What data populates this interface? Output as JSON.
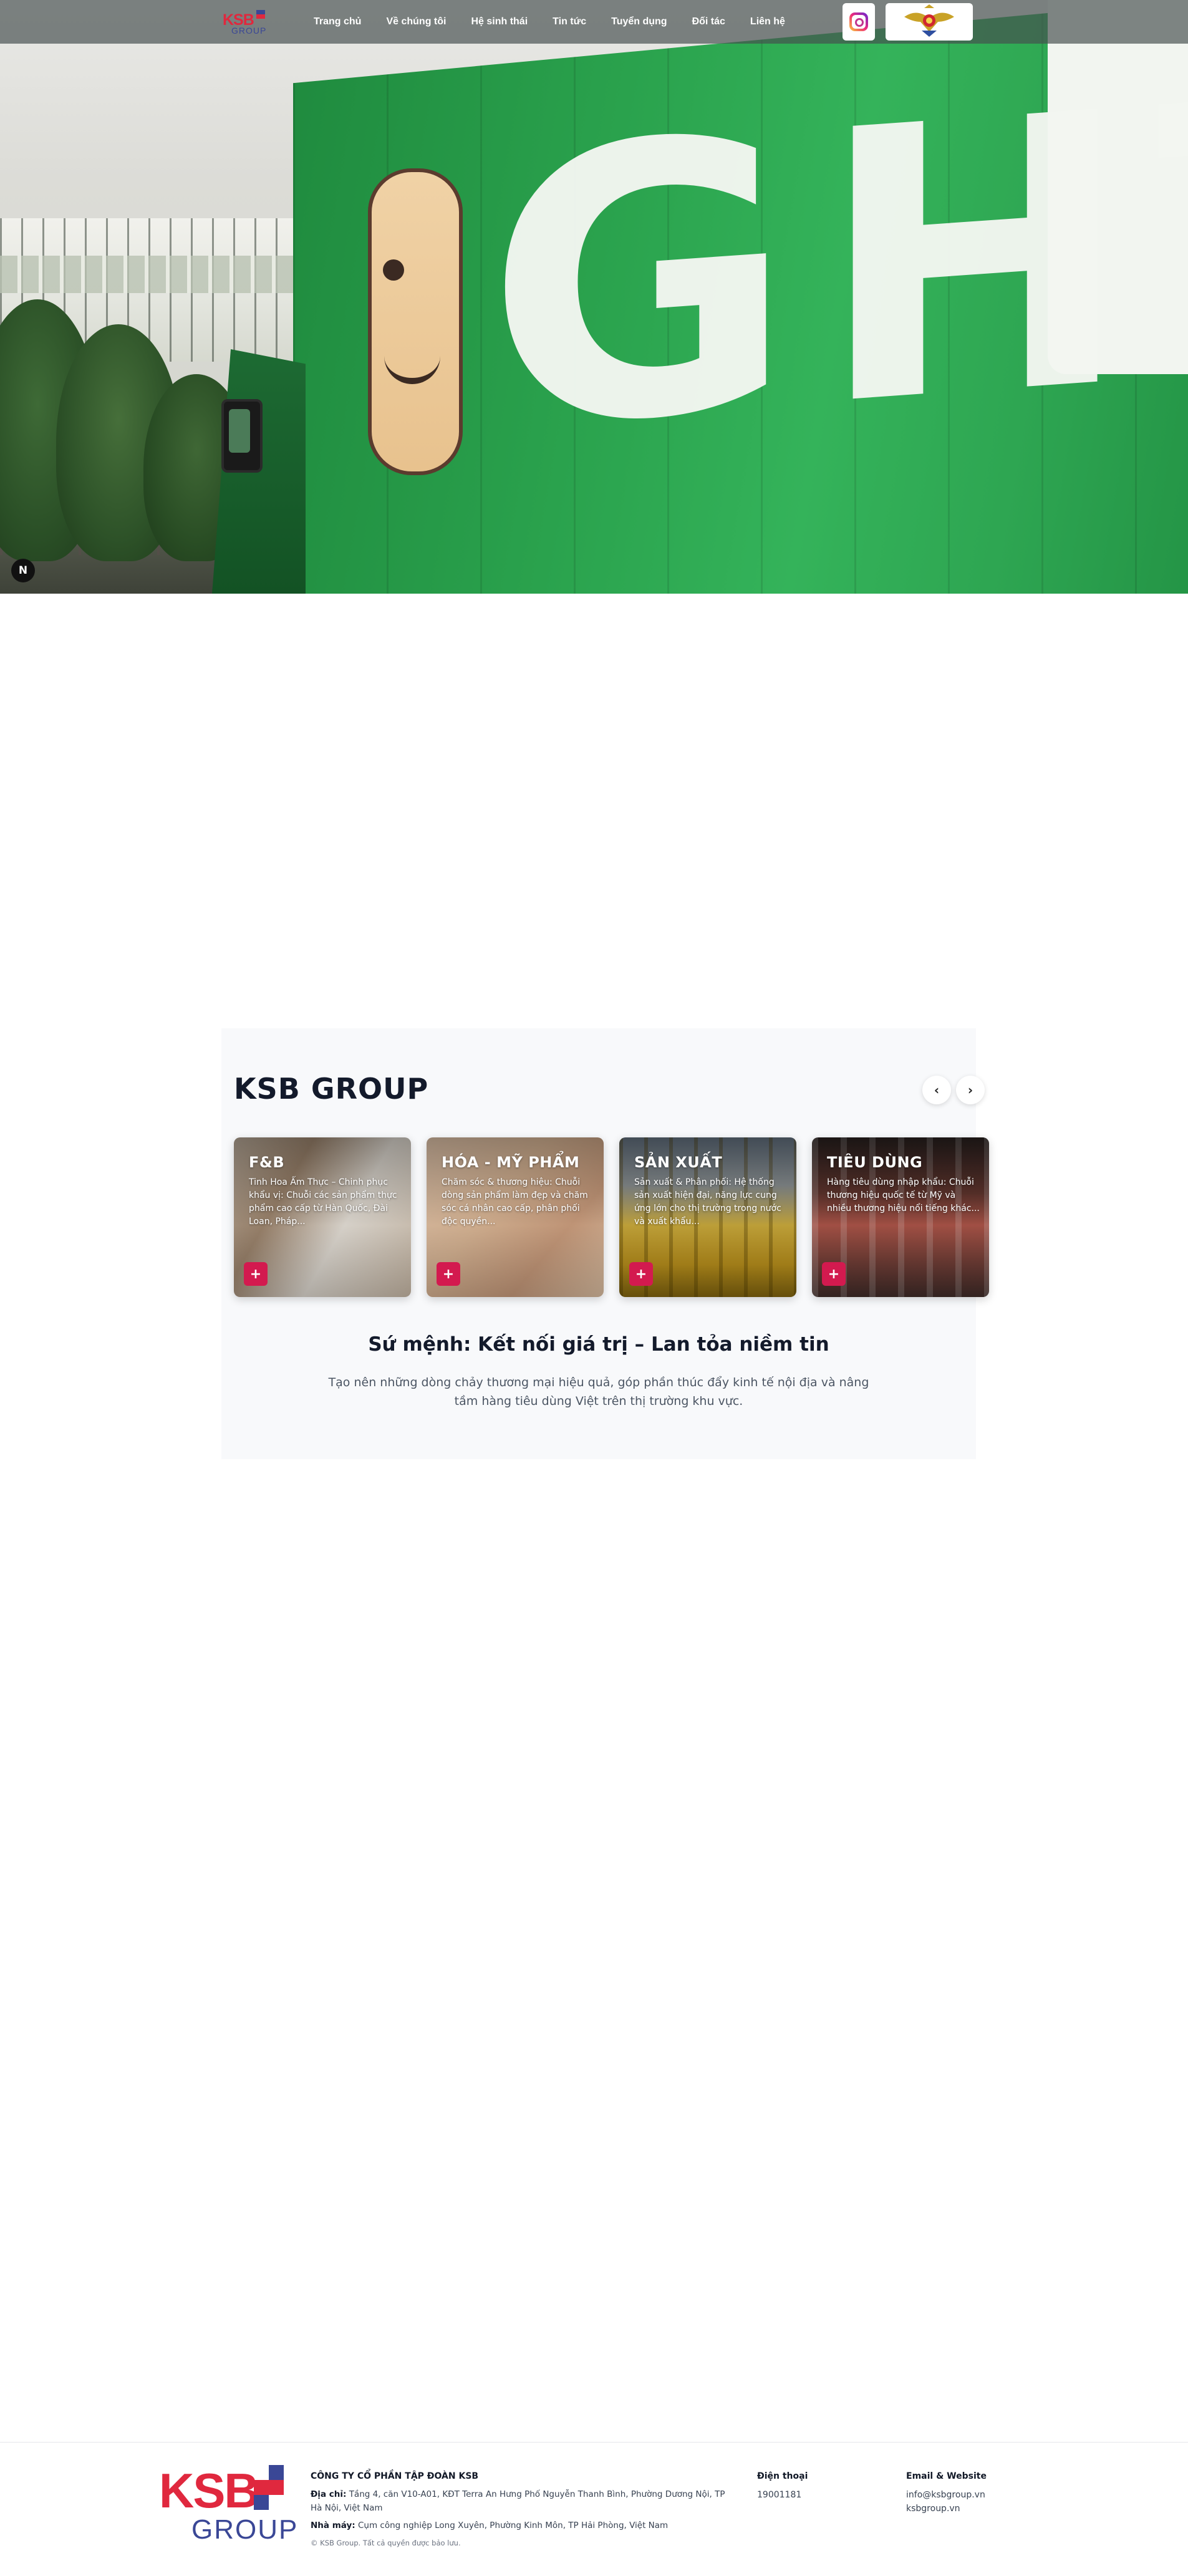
{
  "header": {
    "logo": {
      "top": "KSB",
      "bottom": "GROUP"
    },
    "nav": [
      "Trang chủ",
      "Về chúng tôi",
      "Hệ sinh thái",
      "Tin tức",
      "Tuyển dụng",
      "Đối tác",
      "Liên hệ"
    ]
  },
  "hero": {
    "truck_text": "GHT",
    "badge": "N"
  },
  "ksb_section": {
    "title": "KSB GROUP",
    "prev_icon": "‹",
    "next_icon": "›",
    "cards": [
      {
        "title": "F&B",
        "desc": "Tinh Hoa Ẩm Thực – Chinh phục khẩu vị: Chuỗi các sản phẩm thực phẩm cao cấp từ Hàn Quốc, Đài Loan, Pháp...",
        "plus": "+"
      },
      {
        "title": "HÓA - MỸ PHẨM",
        "desc": "Chăm sóc & thương hiệu: Chuỗi dòng sản phẩm làm đẹp và chăm sóc cá nhân cao cấp, phân phối độc quyền...",
        "plus": "+"
      },
      {
        "title": "SẢN XUẤT",
        "desc": "Sản xuất & Phân phối: Hệ thống sản xuất hiện đại, năng lực cung ứng lớn cho thị trường trong nước và xuất khẩu...",
        "plus": "+"
      },
      {
        "title": "TIÊU DÙNG",
        "desc": "Hàng tiêu dùng nhập khẩu: Chuỗi thương hiệu quốc tế từ Mỹ và nhiều thương hiệu nổi tiếng khác...",
        "plus": "+"
      }
    ],
    "mission_title": "Sứ mệnh: Kết nối giá trị – Lan tỏa niềm tin",
    "mission_text": "Tạo nên những dòng chảy thương mại hiệu quả, góp phần thúc đẩy kinh tế nội địa và nâng tầm hàng tiêu dùng Việt trên thị trường khu vực."
  },
  "footer": {
    "logo": {
      "top": "KSB",
      "bottom": "GROUP"
    },
    "company": "CÔNG TY CỔ PHẦN TẬP ĐOÀN KSB",
    "address_label": "Địa chỉ:",
    "address": "Tầng 4, căn V10-A01, KĐT Terra An Hưng Phố Nguyễn Thanh Bình, Phường Dương Nội, TP Hà Nội, Việt Nam",
    "factory_label": "Nhà máy:",
    "factory": "Cụm công nghiệp Long Xuyên, Phường Kinh Môn, TP Hải Phòng, Việt Nam",
    "copyright": "© KSB Group. Tất cả quyền được bảo lưu.",
    "phone_label": "Điện thoại",
    "phone": "19001181",
    "email_label": "Email & Website",
    "email": "info@ksbgroup.vn",
    "website": "ksbgroup.vn"
  },
  "colors": {
    "brand_red": "#e0283e",
    "brand_blue": "#3a4796",
    "accent": "#d31a4f"
  }
}
